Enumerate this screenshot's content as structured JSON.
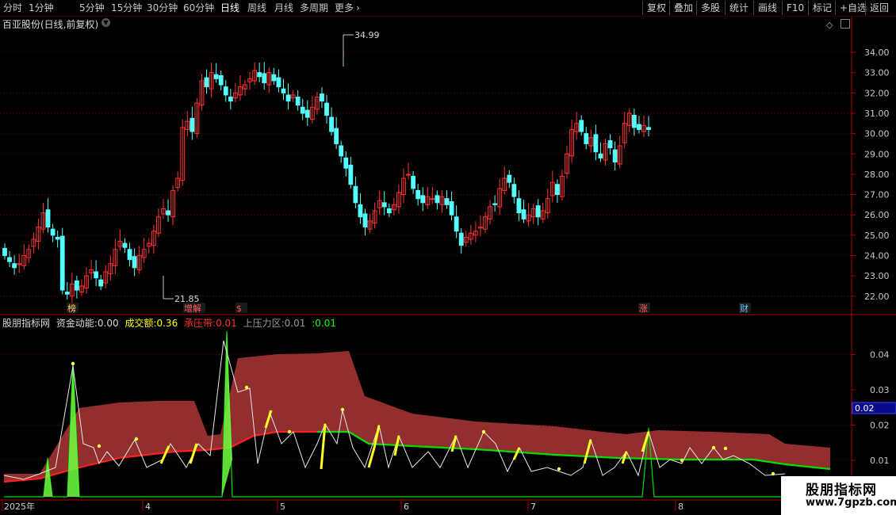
{
  "toolbar": {
    "periods": [
      "分时",
      "1分钟",
      "5分钟",
      "15分钟",
      "30分钟",
      "60分钟",
      "日线",
      "周线",
      "月线",
      "多周期",
      "更多"
    ],
    "active_period": "日线",
    "right_buttons": [
      "复权",
      "叠加",
      "多股",
      "统计",
      "画线",
      "F10",
      "标记",
      "+自选",
      "返回"
    ]
  },
  "main_chart": {
    "title": "百亚股份(日线,前复权)",
    "price_axis": [
      "34.00",
      "33.00",
      "32.00",
      "31.00",
      "30.00",
      "29.00",
      "28.00",
      "27.00",
      "26.00",
      "25.00",
      "24.00",
      "23.00",
      "22.00"
    ],
    "high_label": "34.99",
    "low_label": "21.85",
    "event_markers": [
      "榜",
      "增解",
      "$",
      "涨",
      "财"
    ]
  },
  "indicator": {
    "name": "股朋指标网",
    "items": [
      {
        "label": "资金动能:",
        "value": "0.00",
        "color": "#d8d8d8"
      },
      {
        "label": "成交额:",
        "value": "0.36",
        "color": "#ffff00"
      },
      {
        "label": "承压带:",
        "value": "0.01",
        "color": "#ff3030"
      },
      {
        "label": "上压力区:",
        "value": "0.01",
        "color": "#9a9a9a"
      },
      {
        "label": ":",
        "value": "0.01",
        "color": "#00ff00"
      }
    ],
    "axis": [
      "0.04",
      "0.03",
      "0.02",
      "0.01"
    ],
    "current_value": "0.02"
  },
  "time_axis": [
    "2025年",
    "4",
    "5",
    "6",
    "7",
    "8"
  ],
  "watermark": {
    "line1": "股朋指标网",
    "line2": "www.7gpzb.com"
  },
  "colors": {
    "up": "#ff3232",
    "down": "#54ffff",
    "grid": "#8b0000",
    "band": "#9b3030"
  }
}
